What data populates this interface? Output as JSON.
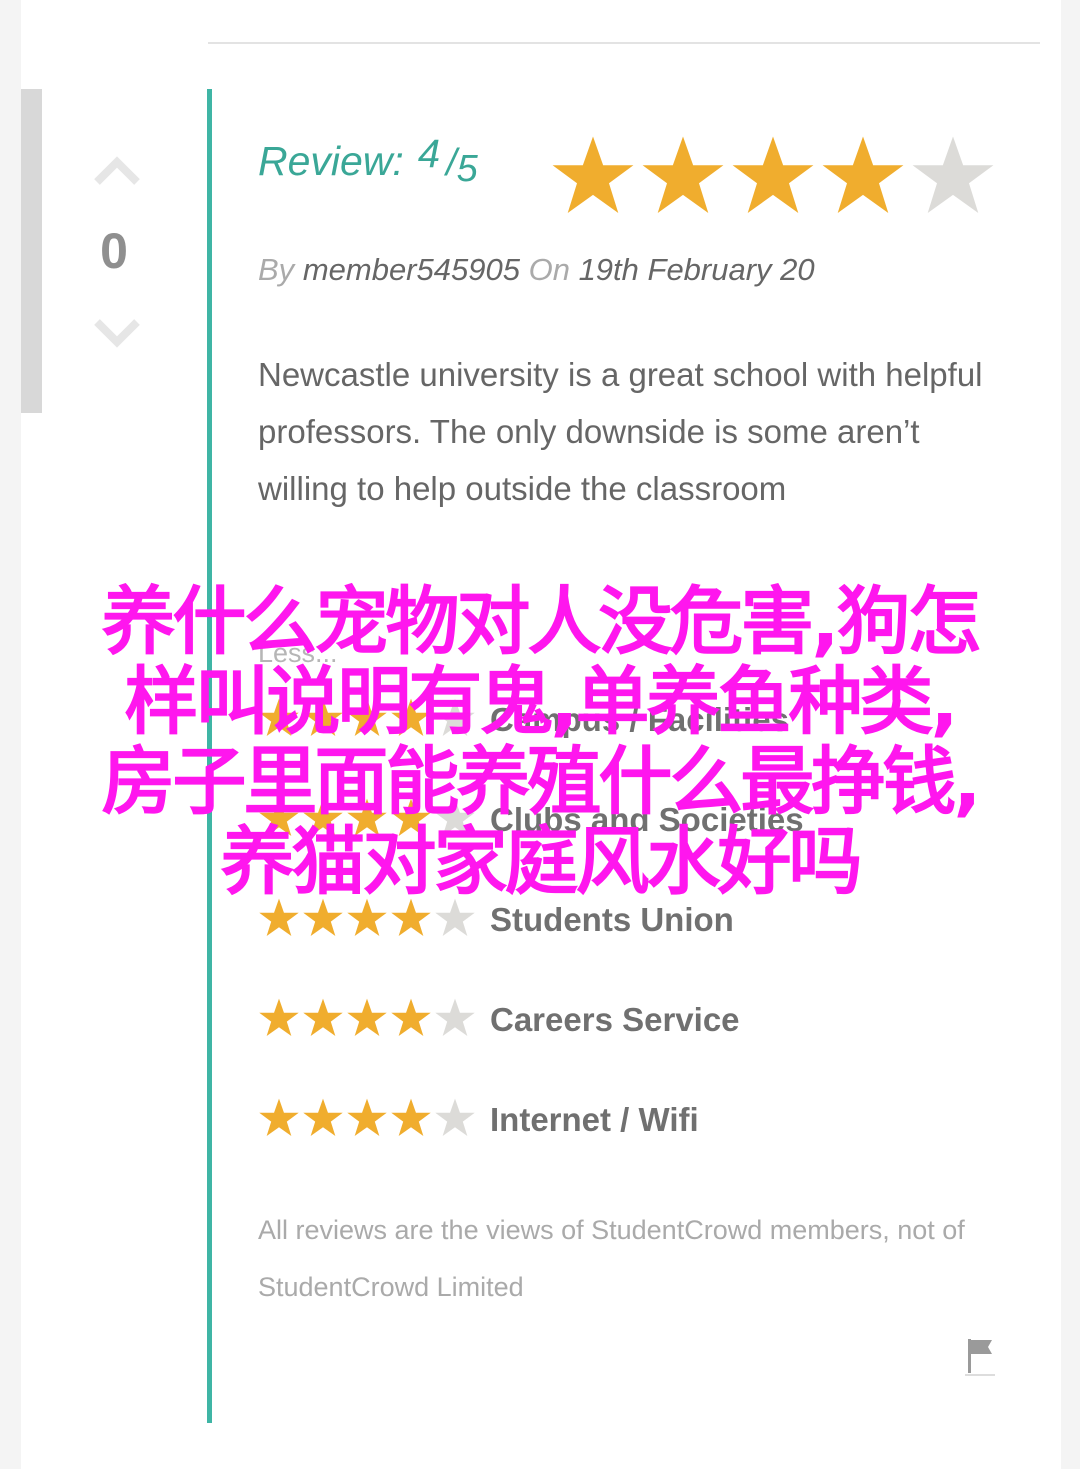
{
  "vote": {
    "count": "0"
  },
  "review": {
    "label": "Review:",
    "score": "4",
    "slash": "/",
    "max": "5",
    "by_label": "By",
    "author": "member545905",
    "on_label": "On",
    "date": "19th February 20",
    "body": "Newcastle university is a great school with helpful professors. The only downside is some aren’t willing to help outside the classroom",
    "less_link": "Less...",
    "stars_filled": 4,
    "stars_total": 5
  },
  "ratings": [
    {
      "category": "Campus / Facilities",
      "stars": 4
    },
    {
      "category": "Clubs and Societies",
      "stars": 4
    },
    {
      "category": "Students Union",
      "stars": 4
    },
    {
      "category": "Careers Service",
      "stars": 4
    },
    {
      "category": "Internet / Wifi",
      "stars": 4
    }
  ],
  "disclaimer": "All reviews are the views of StudentCrowd members, not of StudentCrowd Limited",
  "overlay": {
    "line1": "养什么宠物对人没危害,狗怎",
    "line2": "样叫说明有鬼,单养鱼种类,",
    "line3": "房子里面能养殖什么最挣钱,",
    "line4": "养猫对家庭风水好吗"
  },
  "colors": {
    "teal": "#3fb5a5",
    "star_filled": "#f0ad2e",
    "star_empty": "#dcdbd8",
    "overlay": "#ff16ee"
  },
  "icons": {
    "vote_up": "chevron-up-icon",
    "vote_down": "chevron-down-icon",
    "flag": "flag-icon",
    "star": "star-icon"
  }
}
